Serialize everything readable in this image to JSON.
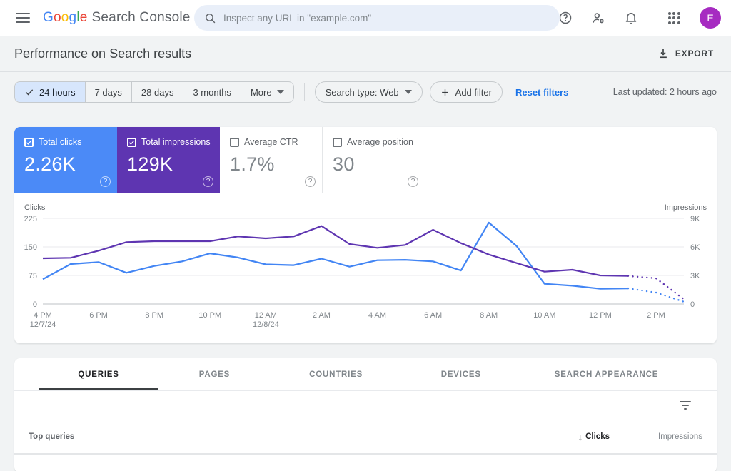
{
  "app_bar": {
    "logo_google_letters": [
      "G",
      "o",
      "o",
      "g",
      "l",
      "e"
    ],
    "logo_product": "Search Console",
    "search_placeholder": "Inspect any URL in \"example.com\"",
    "avatar_letter": "E"
  },
  "toolbar": {
    "title": "Performance on Search results",
    "export_label": "EXPORT"
  },
  "filters": {
    "ranges": [
      {
        "label": "24 hours",
        "selected": true
      },
      {
        "label": "7 days",
        "selected": false
      },
      {
        "label": "28 days",
        "selected": false
      },
      {
        "label": "3 months",
        "selected": false
      },
      {
        "label": "More",
        "selected": false,
        "has_caret": true
      }
    ],
    "search_type": "Search type: Web",
    "add_filter": "Add filter",
    "reset": "Reset filters",
    "last_updated": "Last updated: 2 hours ago"
  },
  "metrics": {
    "cards": [
      {
        "label": "Total clicks",
        "value": "2.26K",
        "checked": true,
        "bg": "#4b8af7"
      },
      {
        "label": "Total impressions",
        "value": "129K",
        "checked": true,
        "bg": "#5e35b1"
      },
      {
        "label": "Average CTR",
        "value": "1.7%",
        "checked": false
      },
      {
        "label": "Average position",
        "value": "30",
        "checked": false
      }
    ]
  },
  "chart_data": {
    "type": "line",
    "x": [
      "4 PM",
      "5 PM",
      "6 PM",
      "7 PM",
      "8 PM",
      "9 PM",
      "10 PM",
      "11 PM",
      "12 AM",
      "1 AM",
      "2 AM",
      "3 AM",
      "4 AM",
      "5 AM",
      "6 AM",
      "7 AM",
      "8 AM",
      "9 AM",
      "10 AM",
      "11 AM",
      "12 PM",
      "1 PM",
      "2 PM",
      "3 PM"
    ],
    "x_ticks": [
      {
        "i": 0,
        "label": "4 PM",
        "sub": "12/7/24"
      },
      {
        "i": 2,
        "label": "6 PM"
      },
      {
        "i": 4,
        "label": "8 PM"
      },
      {
        "i": 6,
        "label": "10 PM"
      },
      {
        "i": 8,
        "label": "12 AM",
        "sub": "12/8/24"
      },
      {
        "i": 10,
        "label": "2 AM"
      },
      {
        "i": 12,
        "label": "4 AM"
      },
      {
        "i": 14,
        "label": "6 AM"
      },
      {
        "i": 16,
        "label": "8 AM"
      },
      {
        "i": 18,
        "label": "10 AM"
      },
      {
        "i": 20,
        "label": "12 PM"
      },
      {
        "i": 22,
        "label": "2 PM"
      }
    ],
    "series": [
      {
        "name": "Clicks",
        "color": "#4285f4",
        "axis": "left",
        "dotted_from": 21,
        "values": [
          65,
          105,
          110,
          82,
          100,
          112,
          133,
          122,
          104,
          102,
          119,
          98,
          115,
          116,
          112,
          88,
          214,
          152,
          53,
          48,
          40,
          41,
          30,
          6
        ]
      },
      {
        "name": "Impressions",
        "color": "#5e35b1",
        "axis": "right",
        "dotted_from": 21,
        "values": [
          4800,
          4850,
          5600,
          6500,
          6600,
          6600,
          6600,
          7100,
          6900,
          7100,
          8200,
          6300,
          5900,
          6200,
          7800,
          6400,
          5200,
          4300,
          3400,
          3600,
          3000,
          2950,
          2700,
          500
        ]
      }
    ],
    "left_axis": {
      "label": "Clicks",
      "ticks": [
        0,
        75,
        150,
        225
      ],
      "max": 225
    },
    "right_axis": {
      "label": "Impressions",
      "ticks": [
        "0",
        "3K",
        "6K",
        "9K"
      ],
      "max": 9000
    },
    "grid": true,
    "legend_position": "none"
  },
  "tabs": {
    "items": [
      {
        "label": "QUERIES",
        "active": true
      },
      {
        "label": "PAGES",
        "active": false
      },
      {
        "label": "COUNTRIES",
        "active": false
      },
      {
        "label": "DEVICES",
        "active": false
      },
      {
        "label": "SEARCH APPEARANCE",
        "active": false
      }
    ]
  },
  "table": {
    "first_col": "Top queries",
    "sort_col": "Clicks",
    "col2": "Impressions"
  }
}
